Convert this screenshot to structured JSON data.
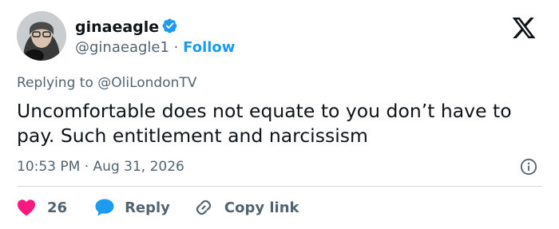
{
  "author": {
    "display_name": "ginaeagle",
    "handle": "@ginaeagle1",
    "separator": "·",
    "follow_label": "Follow"
  },
  "reply": {
    "prefix": "Replying to",
    "mention": "@OliLondonTV"
  },
  "tweet": {
    "text": "Uncomfortable does not equate to you don’t have to pay. Such entitlement and narcissism",
    "time": "10:53 PM",
    "separator": "·",
    "date": "Aug 31, 2026"
  },
  "actions": {
    "like_count": "26",
    "reply_label": "Reply",
    "copy_link_label": "Copy link"
  },
  "colors": {
    "accent": "#1d9bf0",
    "like": "#f91880",
    "secondary_text": "#536471",
    "primary_text": "#0f1419"
  },
  "icons": [
    "verified-badge-icon",
    "x-logo-icon",
    "info-icon",
    "heart-icon",
    "reply-bubble-icon",
    "link-icon"
  ]
}
